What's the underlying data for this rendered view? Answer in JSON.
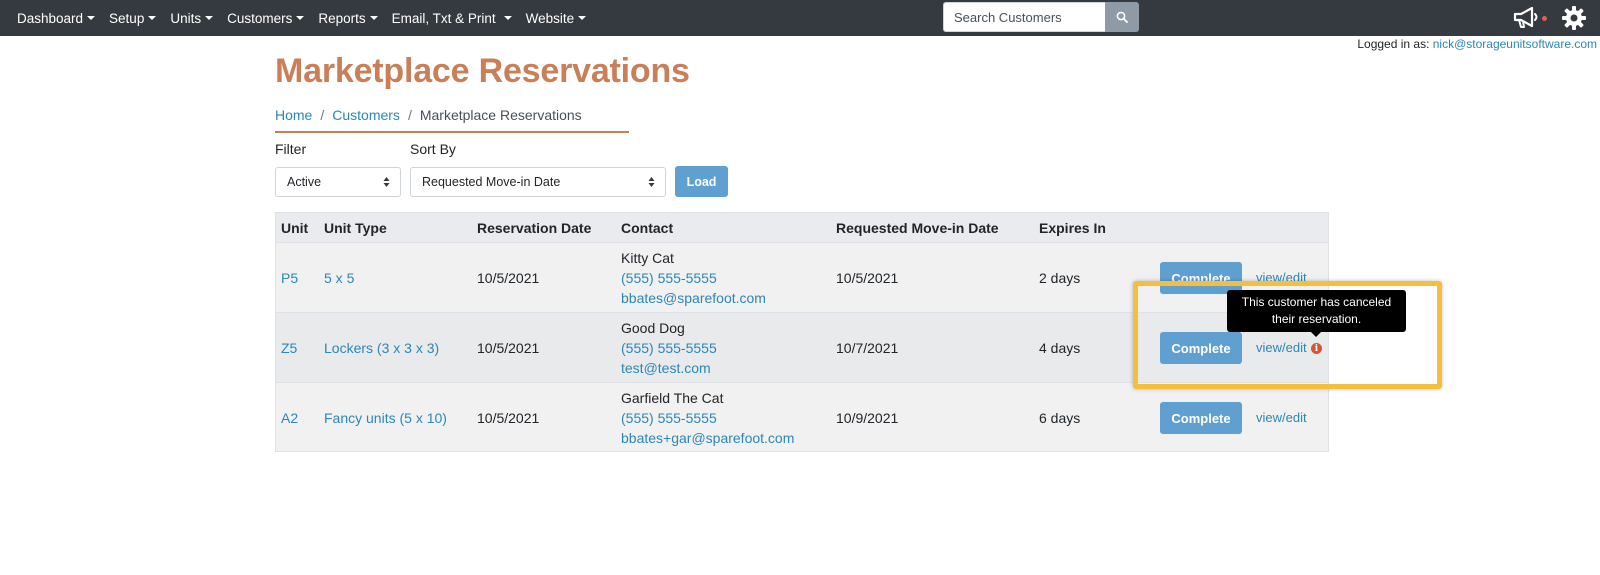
{
  "nav": {
    "items": [
      {
        "label": "Dashboard"
      },
      {
        "label": "Setup"
      },
      {
        "label": "Units"
      },
      {
        "label": "Customers"
      },
      {
        "label": "Reports"
      },
      {
        "label": "Email, Txt & Print"
      },
      {
        "label": "Website"
      }
    ],
    "search_placeholder": "Search Customers",
    "icons": [
      "search-icon",
      "megaphone-icon",
      "gear-icon"
    ]
  },
  "login": {
    "prefix": "Logged in as:",
    "email": "nick@storageunitsoftware.com"
  },
  "page": {
    "title": "Marketplace Reservations",
    "breadcrumb": [
      "Home",
      "Customers",
      "Marketplace Reservations"
    ]
  },
  "filters": {
    "filter_label": "Filter",
    "filter_value": "Active",
    "sort_label": "Sort By",
    "sort_value": "Requested Move-in Date",
    "load_label": "Load"
  },
  "table": {
    "headers": [
      "Unit",
      "Unit Type",
      "Reservation Date",
      "Contact",
      "Requested Move-in Date",
      "Expires In"
    ],
    "rows": [
      {
        "unit": "P5",
        "unit_type": "5 x 5",
        "reservation_date": "10/5/2021",
        "contact_name": "Kitty Cat",
        "contact_phone": "(555) 555-5555",
        "contact_email": "bbates@sparefoot.com",
        "move_in_date": "10/5/2021",
        "expires_in": "2 days",
        "action": "Complete",
        "view": "view/edit"
      },
      {
        "unit": "Z5",
        "unit_type": "Lockers (3 x 3 x 3)",
        "reservation_date": "10/5/2021",
        "contact_name": "Good Dog",
        "contact_phone": "(555) 555-5555",
        "contact_email": "test@test.com",
        "move_in_date": "10/7/2021",
        "expires_in": "4 days",
        "action": "Complete",
        "view": "view/edit",
        "info_icon": "info-icon"
      },
      {
        "unit": "A2",
        "unit_type": "Fancy units (5 x 10)",
        "reservation_date": "10/5/2021",
        "contact_name": "Garfield The Cat",
        "contact_phone": "(555) 555-5555",
        "contact_email": "bbates+gar@sparefoot.com",
        "move_in_date": "10/9/2021",
        "expires_in": "6 days",
        "action": "Complete",
        "view": "view/edit"
      }
    ]
  },
  "tooltip": {
    "line1": "This customer has canceled",
    "line2": "their reservation."
  },
  "colors": {
    "navbar": "#343a40",
    "title": "#c97f57",
    "link": "#2b87b6",
    "button": "#5fa0d1",
    "highlight": "#f2c03e",
    "info": "#d9542f"
  }
}
